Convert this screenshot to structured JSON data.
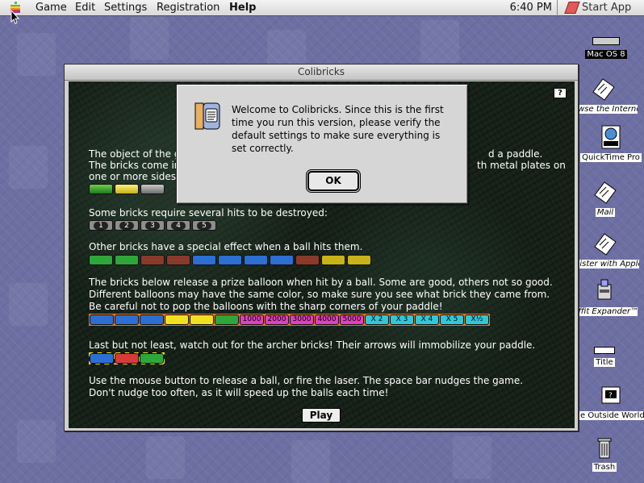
{
  "menubar": {
    "menus": [
      "Game",
      "Edit",
      "Settings",
      "Registration",
      "Help"
    ],
    "clock": "6:40 PM",
    "start_app": "Start App"
  },
  "desktop": {
    "icons": [
      {
        "label": "Mac OS 8",
        "icon": "hard-disk-icon"
      },
      {
        "label": "owse the Internet",
        "icon": "browse-internet-icon"
      },
      {
        "label": "QuickTime Pro",
        "icon": "quicktime-movie-icon"
      },
      {
        "label": "Mail",
        "icon": "mail-icon"
      },
      {
        "label": "gister with Apple",
        "icon": "register-apple-icon"
      },
      {
        "label": "uffit Expander™",
        "icon": "stuffit-expander-icon"
      },
      {
        "label": "Title",
        "icon": "document-icon"
      },
      {
        "label": "e Outside World",
        "icon": "outside-world-icon"
      },
      {
        "label": "Trash",
        "icon": "trash-icon"
      }
    ]
  },
  "window": {
    "title": "Colibricks",
    "help": "?",
    "lines": {
      "p1a": "The object of the g",
      "p1a_right": "d a paddle.",
      "p1b": "The bricks come ir",
      "p1b_right": "th metal plates on",
      "p1c": "one or more sides",
      "p2": "Some bricks require several hits to be destroyed:",
      "p3": "Other bricks have a special effect when a ball hits them.",
      "p4a": "The bricks below release a prize balloon when hit by a ball. Some are good, others not so good.",
      "p4b": "Different balloons may have the same color, so make sure you see what brick they came from.",
      "p4c": "Be careful not to pop the balloons with the sharp corners of your paddle!",
      "p5": "Last but not least, watch out for the archer bricks! Their arrows will immobilize your paddle.",
      "p6a": "Use the mouse button to release a ball, or fire the laser. The space bar nudges the game.",
      "p6b": "Don't nudge too often, as it will speed up the balls each time!"
    },
    "hit_bricks": [
      "1",
      "2",
      "3",
      "4",
      "5"
    ],
    "prize_bricks": [
      "1000",
      "2000",
      "3000",
      "4000",
      "5000",
      "X 2",
      "X 3",
      "X 4",
      "X 5",
      "X½"
    ],
    "play_label": "Play"
  },
  "dialog": {
    "message_lines": [
      "Welcome to Colibricks. Since this is the first",
      "time you run this version, please verify the",
      "default settings to make sure everything is",
      "set correctly."
    ],
    "ok_label": "OK"
  },
  "colors": {
    "desktop": "#6d6fa3",
    "game_bg": "#162118",
    "text": "#ffffff"
  }
}
